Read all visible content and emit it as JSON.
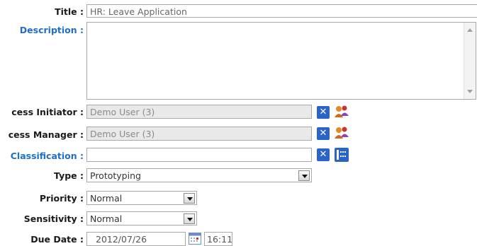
{
  "fields": {
    "title": {
      "label": "Title :",
      "value": "HR: Leave Application"
    },
    "description": {
      "label": "Description :",
      "value": ""
    },
    "process_initiator": {
      "label": "cess Initiator :",
      "value": "Demo User (3)"
    },
    "process_manager": {
      "label": "cess Manager :",
      "value": "Demo User (3)"
    },
    "classification": {
      "label": "Classification :",
      "value": ""
    },
    "type": {
      "label": "Type :",
      "value": "Prototyping"
    },
    "priority": {
      "label": "Priority :",
      "value": "Normal"
    },
    "sensitivity": {
      "label": "Sensitivity :",
      "value": "Normal"
    },
    "due_date": {
      "label": "Due Date :",
      "date": "2012/07/26",
      "time": "16:11"
    }
  },
  "buttons": {
    "clear_symbol": "✕"
  },
  "icons": [
    "users-icon",
    "tree-icon",
    "calendar-icon",
    "dropdown-arrow-icon"
  ],
  "colors": {
    "accent_label": "#1f6fc9",
    "clear_button": "#2b64c8",
    "readonly_bg": "#e9e9e9"
  }
}
